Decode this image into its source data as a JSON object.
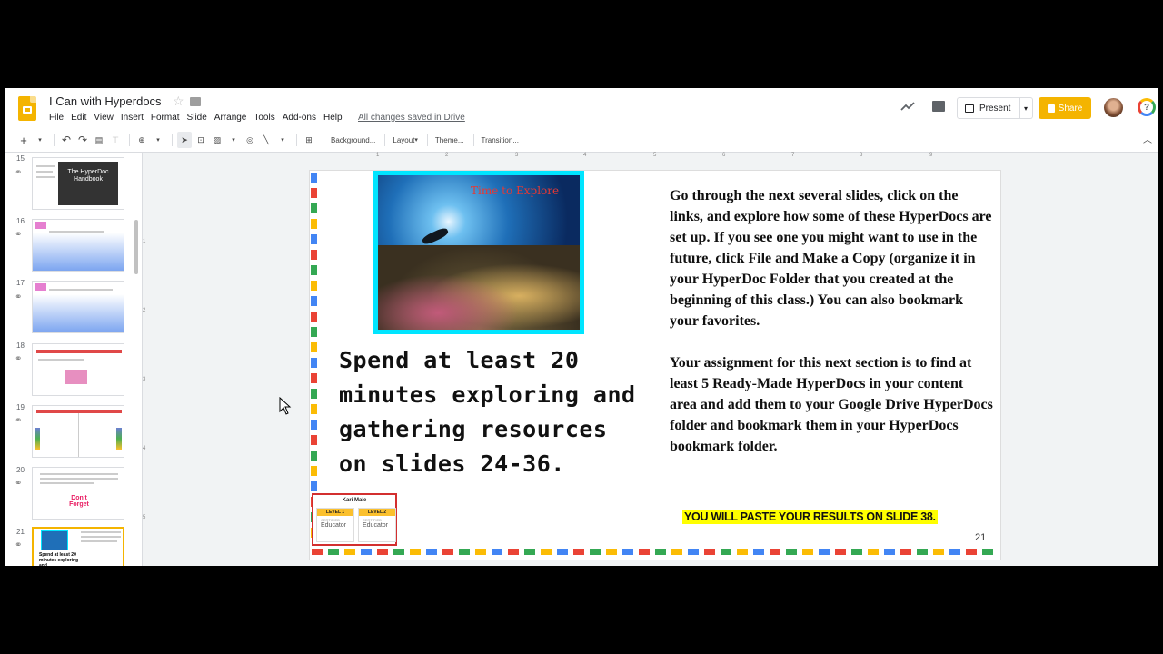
{
  "header": {
    "doc_title": "I Can with Hyperdocs",
    "menus": [
      "File",
      "Edit",
      "View",
      "Insert",
      "Format",
      "Slide",
      "Arrange",
      "Tools",
      "Add-ons",
      "Help"
    ],
    "save_status": "All changes saved in Drive",
    "present_label": "Present",
    "share_label": "Share",
    "help_glyph": "?"
  },
  "toolbar": {
    "background_label": "Background...",
    "layout_label": "Layout",
    "theme_label": "Theme...",
    "transition_label": "Transition..."
  },
  "ruler": {
    "h_ticks": [
      "1",
      "2",
      "3",
      "4",
      "5",
      "6",
      "7",
      "8",
      "9"
    ],
    "v_ticks": [
      "1",
      "2",
      "3",
      "4",
      "5"
    ]
  },
  "filmstrip": {
    "slides": [
      {
        "num": "15",
        "title": "The HyperDoc Handbook"
      },
      {
        "num": "16"
      },
      {
        "num": "17"
      },
      {
        "num": "18"
      },
      {
        "num": "19"
      },
      {
        "num": "20",
        "title": "Don't Forget"
      },
      {
        "num": "21",
        "caption": "Spend at least 20 minutes exploring and"
      }
    ]
  },
  "slide": {
    "photo_title": "Time to Explore",
    "main_text": "Spend at least 20 minutes exploring and gathering resources on slides 24-36.",
    "paragraph_1": "Go through the next several slides, click on the links, and explore how some of these HyperDocs are set up.  If you see one you might want to use in the future, click File and Make a Copy (organize it in your HyperDoc Folder that you created at the beginning of this class.) You can also bookmark your favorites.",
    "paragraph_2": "Your assignment for this next section is to find at least 5 Ready-Made HyperDocs in your content area and add them to your Google Drive HyperDocs folder and bookmark them in your HyperDocs bookmark folder.",
    "paste_note": "YOU WILL PASTE YOUR RESULTS ON SLIDE 38.",
    "page_number": "21",
    "badge": {
      "name": "Kari Male",
      "level1": "LEVEL 1",
      "level2": "LEVEL 2",
      "cert": "CERTIFIED",
      "role": "Educator"
    },
    "dot_colors": [
      "#4285f4",
      "#ea4335",
      "#34a853",
      "#fbbc05"
    ]
  },
  "colors": {
    "accent": "#f4b400",
    "frame": "#00e5ff",
    "highlight": "#ffff00"
  }
}
